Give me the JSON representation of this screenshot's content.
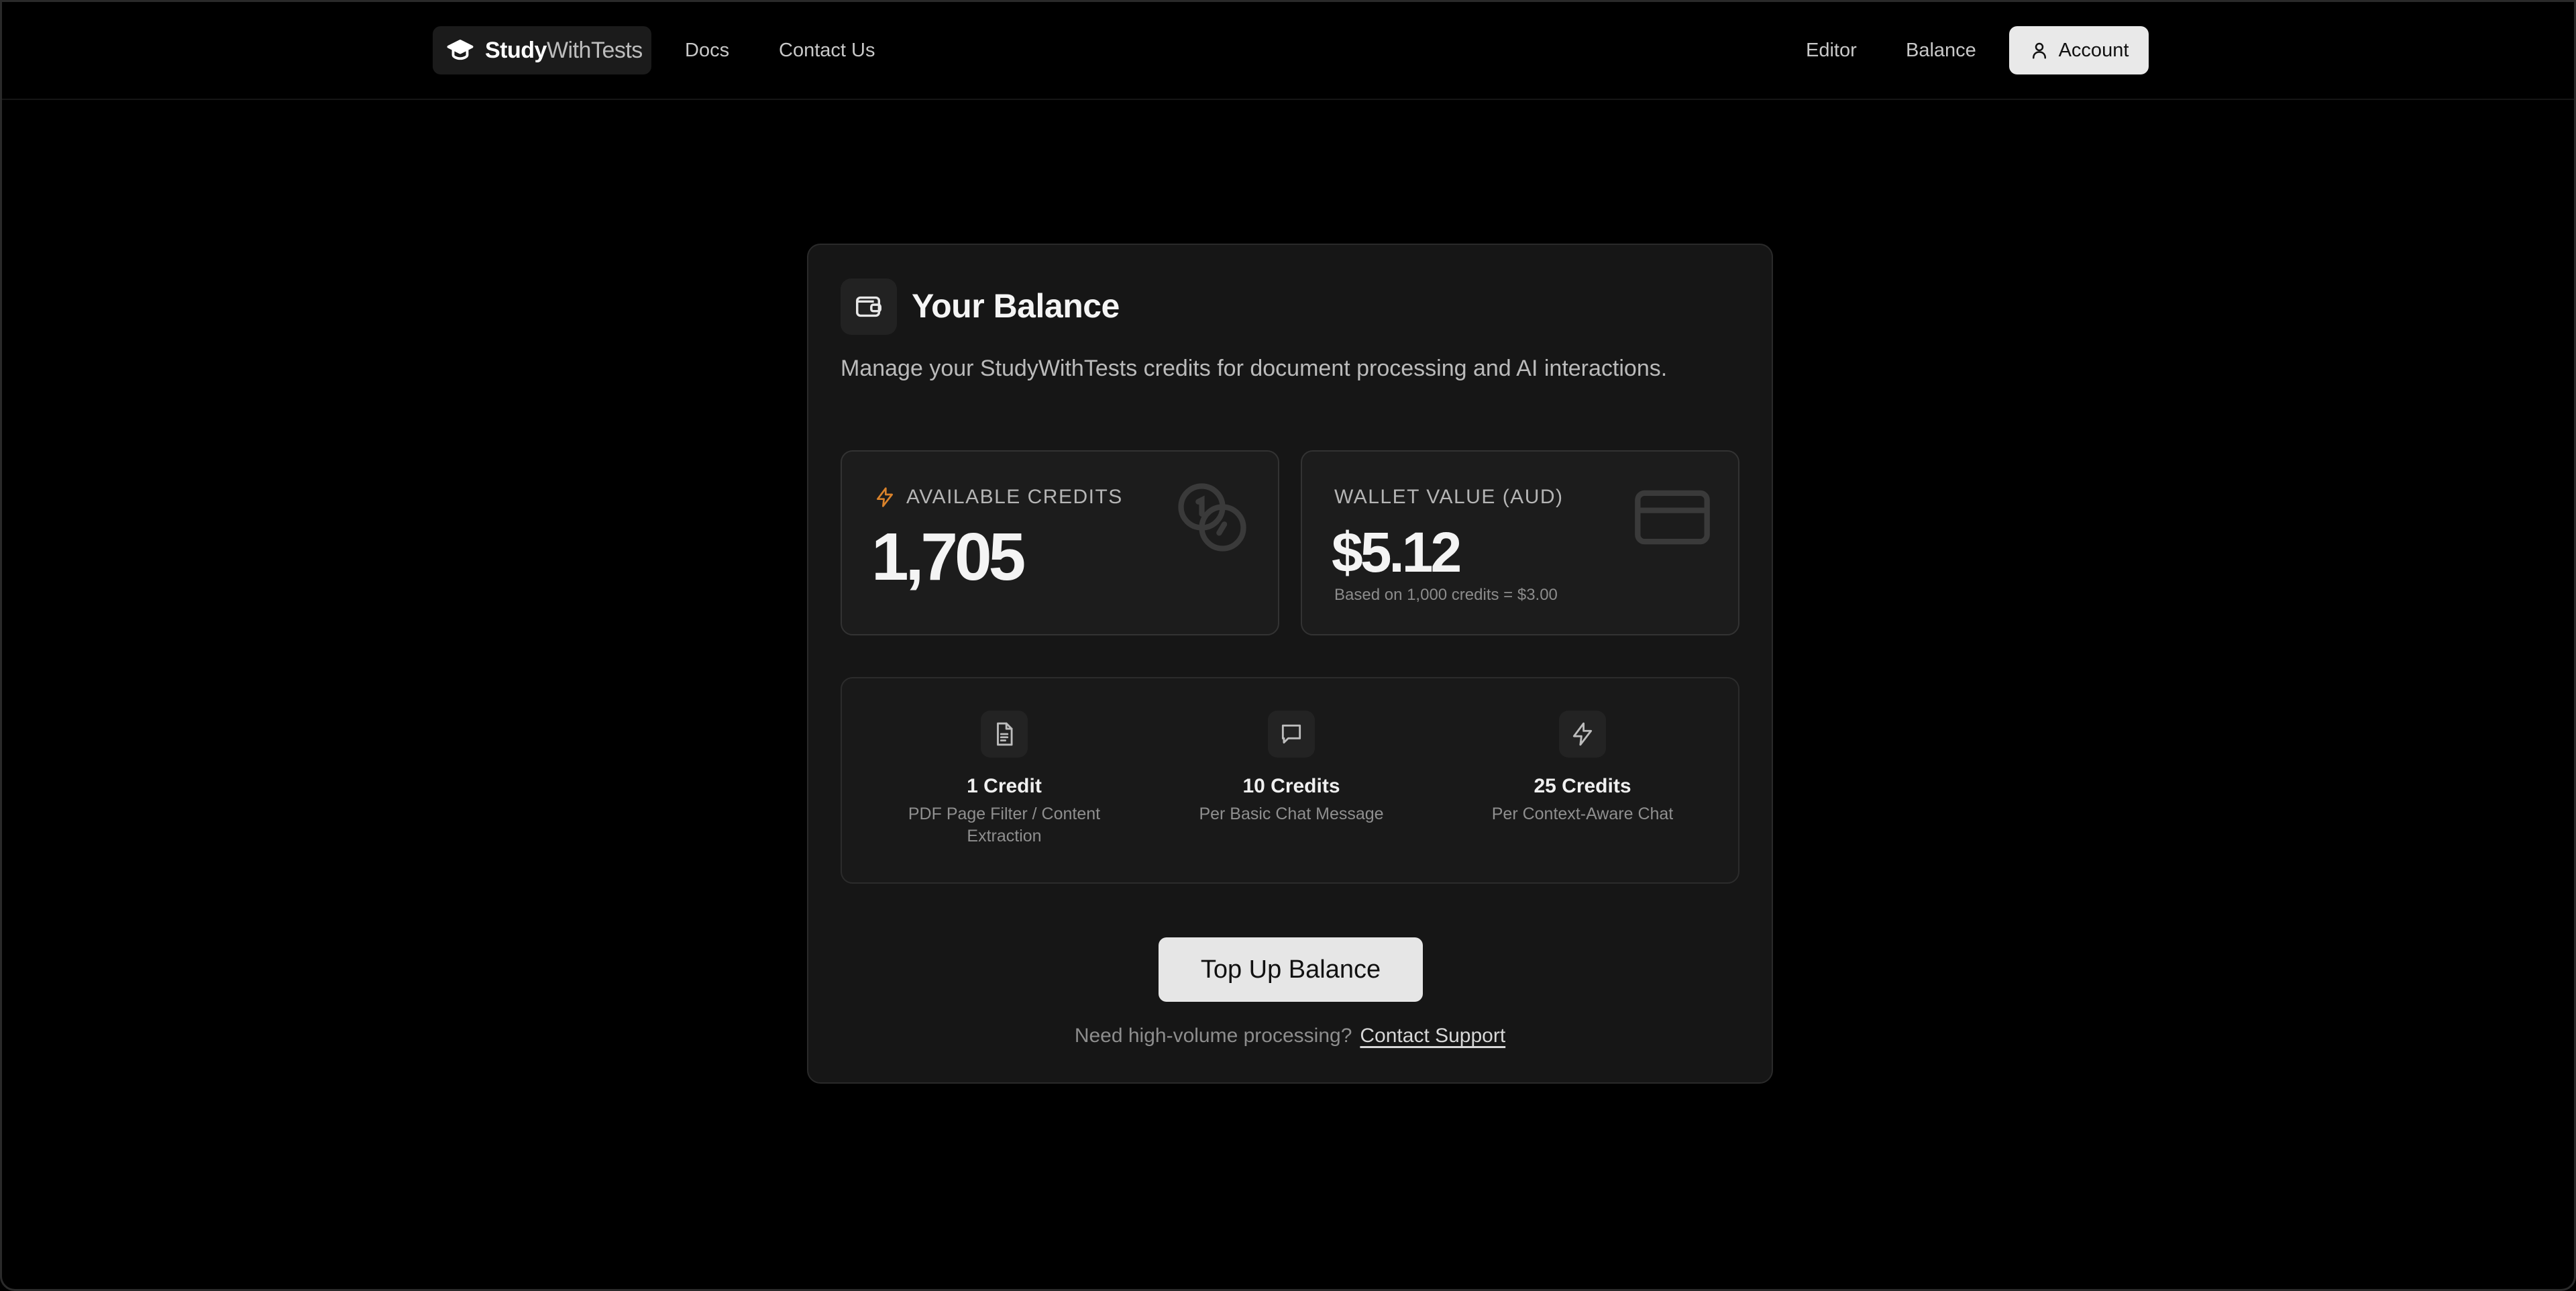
{
  "nav": {
    "brand_bold": "Study",
    "brand_rest": "WithTests",
    "links": [
      {
        "label": "Docs"
      },
      {
        "label": "Contact Us"
      },
      {
        "label": "Editor"
      },
      {
        "label": "Balance"
      }
    ],
    "account_label": "Account"
  },
  "balance": {
    "title": "Your Balance",
    "subtitle": "Manage your StudyWithTests credits for document processing and AI interactions.",
    "credits": {
      "label": "AVAILABLE CREDITS",
      "value": "1,705",
      "accent": "#d9822b"
    },
    "wallet": {
      "label": "WALLET VALUE (AUD)",
      "value": "$5.12",
      "note": "Based on 1,000 credits = $3.00"
    },
    "rates": [
      {
        "icon": "document-icon",
        "amount": "1 Credit",
        "desc_line1": "PDF Page Filter / Content",
        "desc_line2": "Extraction"
      },
      {
        "icon": "chat-icon",
        "amount": "10 Credits",
        "desc_line1": "Per Basic Chat Message",
        "desc_line2": ""
      },
      {
        "icon": "bolt-icon",
        "amount": "25 Credits",
        "desc_line1": "Per Context-Aware Chat",
        "desc_line2": ""
      }
    ],
    "topup_label": "Top Up Balance",
    "help_text": "Need high-volume processing?",
    "help_link": "Contact Support"
  }
}
